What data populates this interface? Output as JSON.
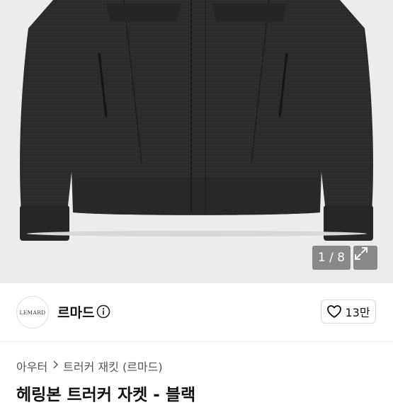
{
  "gallery": {
    "counter": "1 / 8",
    "expand_icon": "expand-arrows-icon",
    "image_alt": "jacket-photo"
  },
  "seller": {
    "logo_text": "LEMARD",
    "name": "르마드",
    "info_icon": "info-circle-icon"
  },
  "like": {
    "icon": "heart-outline-icon",
    "count": "13만"
  },
  "breadcrumb": {
    "items": [
      "아우터",
      "트러커 재킷 (르마드)"
    ],
    "separator_icon": "chevron-right-icon"
  },
  "product": {
    "title": "헤링본 트러커 자켓 - 블랙"
  },
  "colors": {
    "hero_bg": "#ececec",
    "jacket": "#2c2c2e",
    "overlay": "#787878"
  }
}
